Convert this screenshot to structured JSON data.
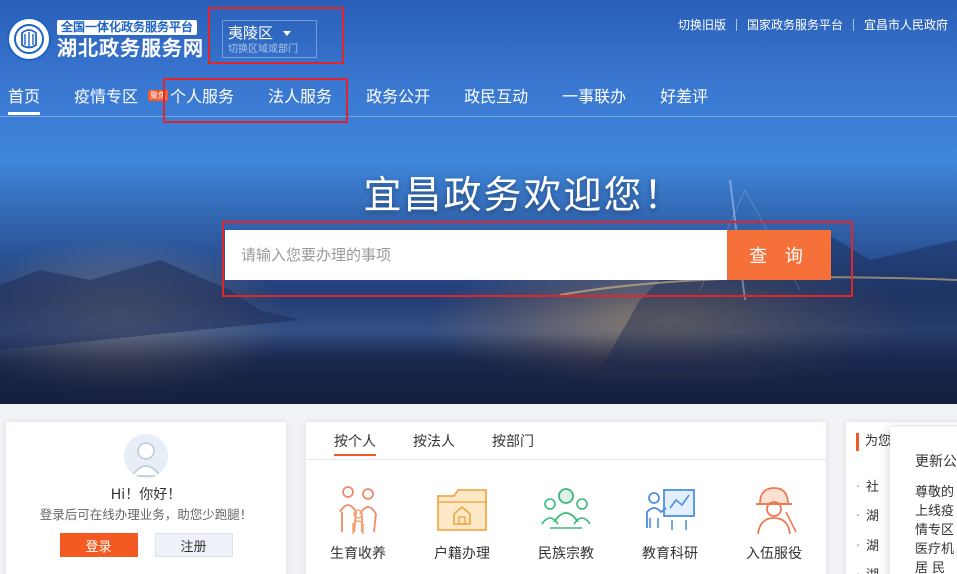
{
  "header": {
    "logo_subtitle": "全国一体化政务服务平台",
    "logo_title": "湖北政务服务网",
    "region": {
      "name": "夷陵区",
      "tip": "切换区域或部门"
    },
    "top_links": [
      "切换旧版",
      "国家政务服务平台",
      "宜昌市人民政府"
    ]
  },
  "nav": {
    "items": [
      {
        "label": "首页",
        "active": true
      },
      {
        "label": "疫情专区",
        "badge": "聚焦"
      },
      {
        "label": "个人服务"
      },
      {
        "label": "法人服务"
      },
      {
        "label": "政务公开"
      },
      {
        "label": "政民互动"
      },
      {
        "label": "一事联办"
      },
      {
        "label": "好差评"
      }
    ]
  },
  "hero": {
    "welcome": "宜昌政务欢迎您！",
    "search_placeholder": "请输入您要办理的事项",
    "search_button": "查 询"
  },
  "user_panel": {
    "greeting": "Hi！你好！",
    "tip": "登录后可在线办理业务，助您少跑腿！",
    "login": "登录",
    "register": "注册"
  },
  "services": {
    "tabs": [
      "按个人",
      "按法人",
      "按部门"
    ],
    "items": [
      {
        "label": "生育收养",
        "icon": "family-icon"
      },
      {
        "label": "户籍办理",
        "icon": "household-folder-icon"
      },
      {
        "label": "民族宗教",
        "icon": "people-group-icon"
      },
      {
        "label": "教育科研",
        "icon": "teacher-board-icon"
      },
      {
        "label": "入伍服役",
        "icon": "soldier-helmet-icon"
      }
    ]
  },
  "news": {
    "title": "为您",
    "items": [
      "社",
      "湖",
      "湖",
      "湖"
    ]
  },
  "popup": {
    "title": "更新公",
    "lines": [
      "尊敬的",
      "上线疫",
      "情专区",
      "医疗机",
      "居 民"
    ]
  },
  "colors": {
    "accent": "#f25a22",
    "search_button": "#f6703a",
    "highlight": "#e0262b",
    "brand_blue": "#1e63c6"
  }
}
